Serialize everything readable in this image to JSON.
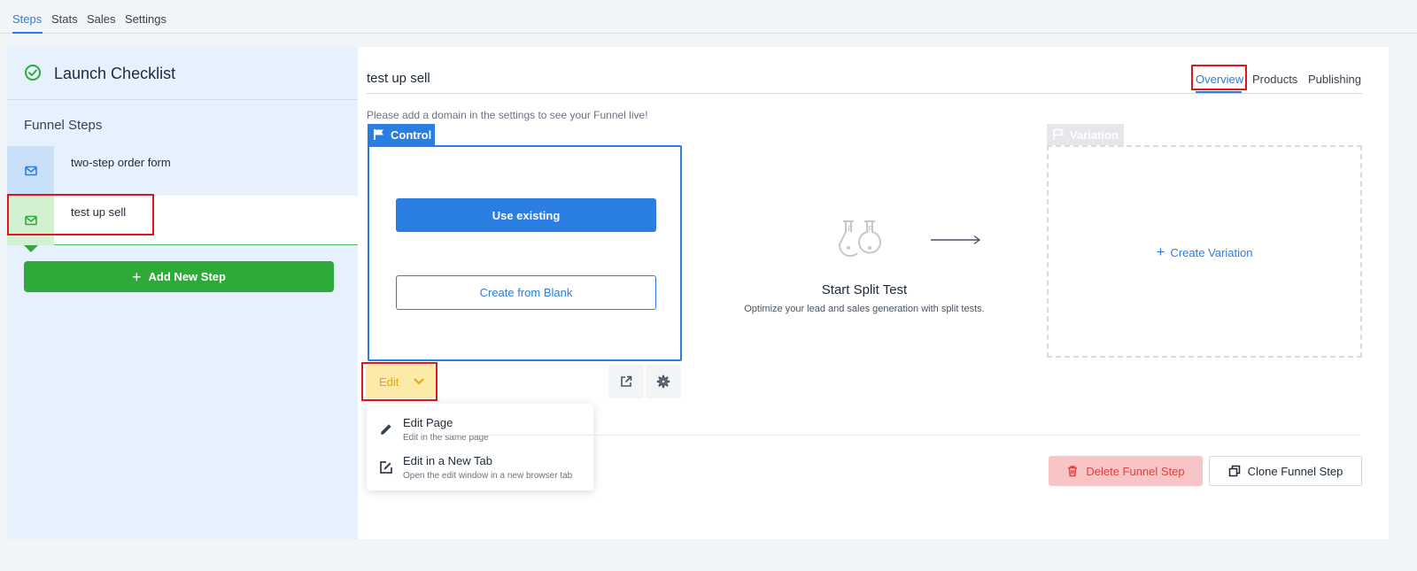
{
  "topnav": {
    "tabs": [
      {
        "label": "Steps"
      },
      {
        "label": "Stats"
      },
      {
        "label": "Sales"
      },
      {
        "label": "Settings"
      }
    ],
    "active": "Steps"
  },
  "sidebar": {
    "checklist_title": "Launch Checklist",
    "funnel_steps_label": "Funnel Steps",
    "steps": [
      {
        "label": "two-step order form",
        "icon": "mail-icon"
      },
      {
        "label": "test up sell",
        "icon": "mail-icon",
        "selected": true
      }
    ],
    "add_step_label": "Add New Step"
  },
  "main": {
    "title": "test up sell",
    "tabs": [
      {
        "label": "Overview"
      },
      {
        "label": "Products"
      },
      {
        "label": "Publishing"
      }
    ],
    "active_tab": "Overview",
    "domain_note": "Please add a domain in the settings to see your Funnel live!",
    "control": {
      "tag_label": "Control",
      "use_existing_label": "Use existing",
      "create_blank_label": "Create from Blank",
      "edit_label": "Edit"
    },
    "edit_menu": [
      {
        "title": "Edit Page",
        "subtitle": "Edit in the same page",
        "icon": "pencil-icon"
      },
      {
        "title": "Edit in a New Tab",
        "subtitle": "Open the edit window in a new browser tab",
        "icon": "edit-external-icon"
      }
    ],
    "split_test": {
      "title": "Start Split Test",
      "subtitle": "Optimize your lead and sales generation with split tests."
    },
    "variation": {
      "tag_label": "Variation",
      "create_label": "Create Variation"
    },
    "delete_label": "Delete Funnel Step",
    "clone_label": "Clone Funnel Step"
  },
  "colors": {
    "accent": "#2a7de1",
    "success": "#2eaa38",
    "warning": "#e6a310",
    "danger": "#e14040",
    "highlight": "#e2141c"
  }
}
